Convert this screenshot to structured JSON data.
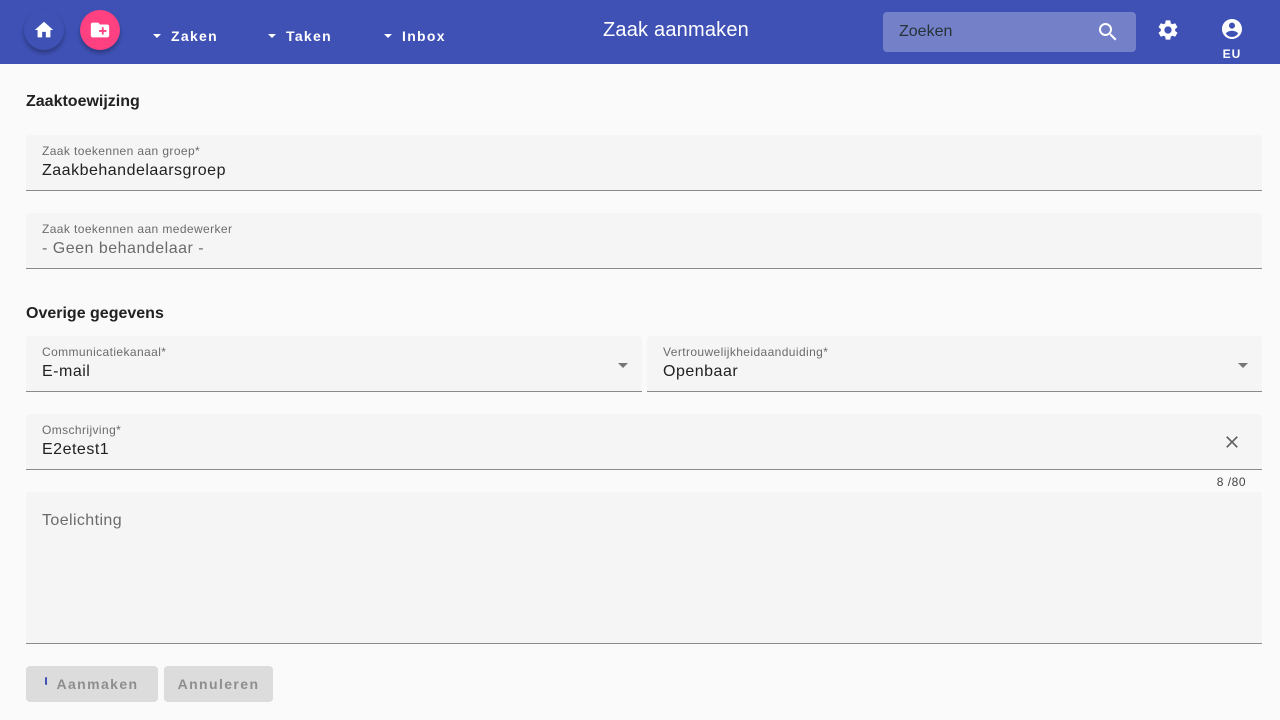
{
  "header": {
    "menus": [
      {
        "label": "Zaken"
      },
      {
        "label": "Taken"
      },
      {
        "label": "Inbox"
      }
    ],
    "title": "Zaak aanmaken",
    "search_placeholder": "Zoeken",
    "user_label": "EU",
    "icons": {
      "home": "home-icon",
      "add": "create-new-folder-icon",
      "search": "search-icon",
      "settings": "gear-icon",
      "user": "account-circle-icon"
    },
    "colors": {
      "primary": "#3f51b5",
      "accent": "#ff4081"
    }
  },
  "sections": {
    "assignment": "Zaaktoewijzing",
    "other": "Overige gegevens"
  },
  "fields": {
    "group": {
      "label": "Zaak toekennen aan groep*",
      "value": "Zaakbehandelaarsgroep"
    },
    "employee": {
      "label": "Zaak toekennen aan medewerker",
      "value": "- Geen behandelaar -"
    },
    "channel": {
      "label": "Communicatiekanaal*",
      "value": "E-mail"
    },
    "confidentiality": {
      "label": "Vertrouwelijkheidaanduiding*",
      "value": "Openbaar"
    },
    "description": {
      "label": "Omschrijving*",
      "value": "E2etest1",
      "counter": "8 /80"
    },
    "explanation": {
      "placeholder": "Toelichting"
    }
  },
  "actions": {
    "create": "Aanmaken",
    "cancel": "Annuleren"
  }
}
